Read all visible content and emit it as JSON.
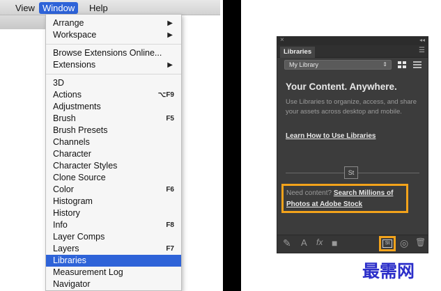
{
  "menubar": {
    "view": "View",
    "window": "Window",
    "help": "Help"
  },
  "window_menu": {
    "items": [
      {
        "label": "Arrange",
        "submenu": true
      },
      {
        "label": "Workspace",
        "submenu": true
      },
      {
        "label": "Browse Extensions Online..."
      },
      {
        "label": "Extensions",
        "submenu": true
      },
      {
        "label": "3D"
      },
      {
        "label": "Actions",
        "shortcut": "⌥F9"
      },
      {
        "label": "Adjustments"
      },
      {
        "label": "Brush",
        "shortcut": "F5"
      },
      {
        "label": "Brush Presets"
      },
      {
        "label": "Channels"
      },
      {
        "label": "Character"
      },
      {
        "label": "Character Styles"
      },
      {
        "label": "Clone Source"
      },
      {
        "label": "Color",
        "shortcut": "F6"
      },
      {
        "label": "Histogram"
      },
      {
        "label": "History"
      },
      {
        "label": "Info",
        "shortcut": "F8"
      },
      {
        "label": "Layer Comps"
      },
      {
        "label": "Layers",
        "shortcut": "F7"
      },
      {
        "label": "Libraries",
        "selected": true
      },
      {
        "label": "Measurement Log"
      },
      {
        "label": "Navigator"
      }
    ]
  },
  "libraries_panel": {
    "tab": "Libraries",
    "library_select": "My Library",
    "heading": "Your Content. Anywhere.",
    "body": "Use Libraries to organize, access, and share your assets across desktop and mobile.",
    "learn_link": "Learn How to Use Libraries",
    "stock_badge": "St",
    "need_content": "Need content?",
    "stock_link": "Search Millions of Photos at Adobe Stock",
    "footer_stock": "St",
    "accent": "#f3a31b"
  },
  "watermark": "最需网"
}
